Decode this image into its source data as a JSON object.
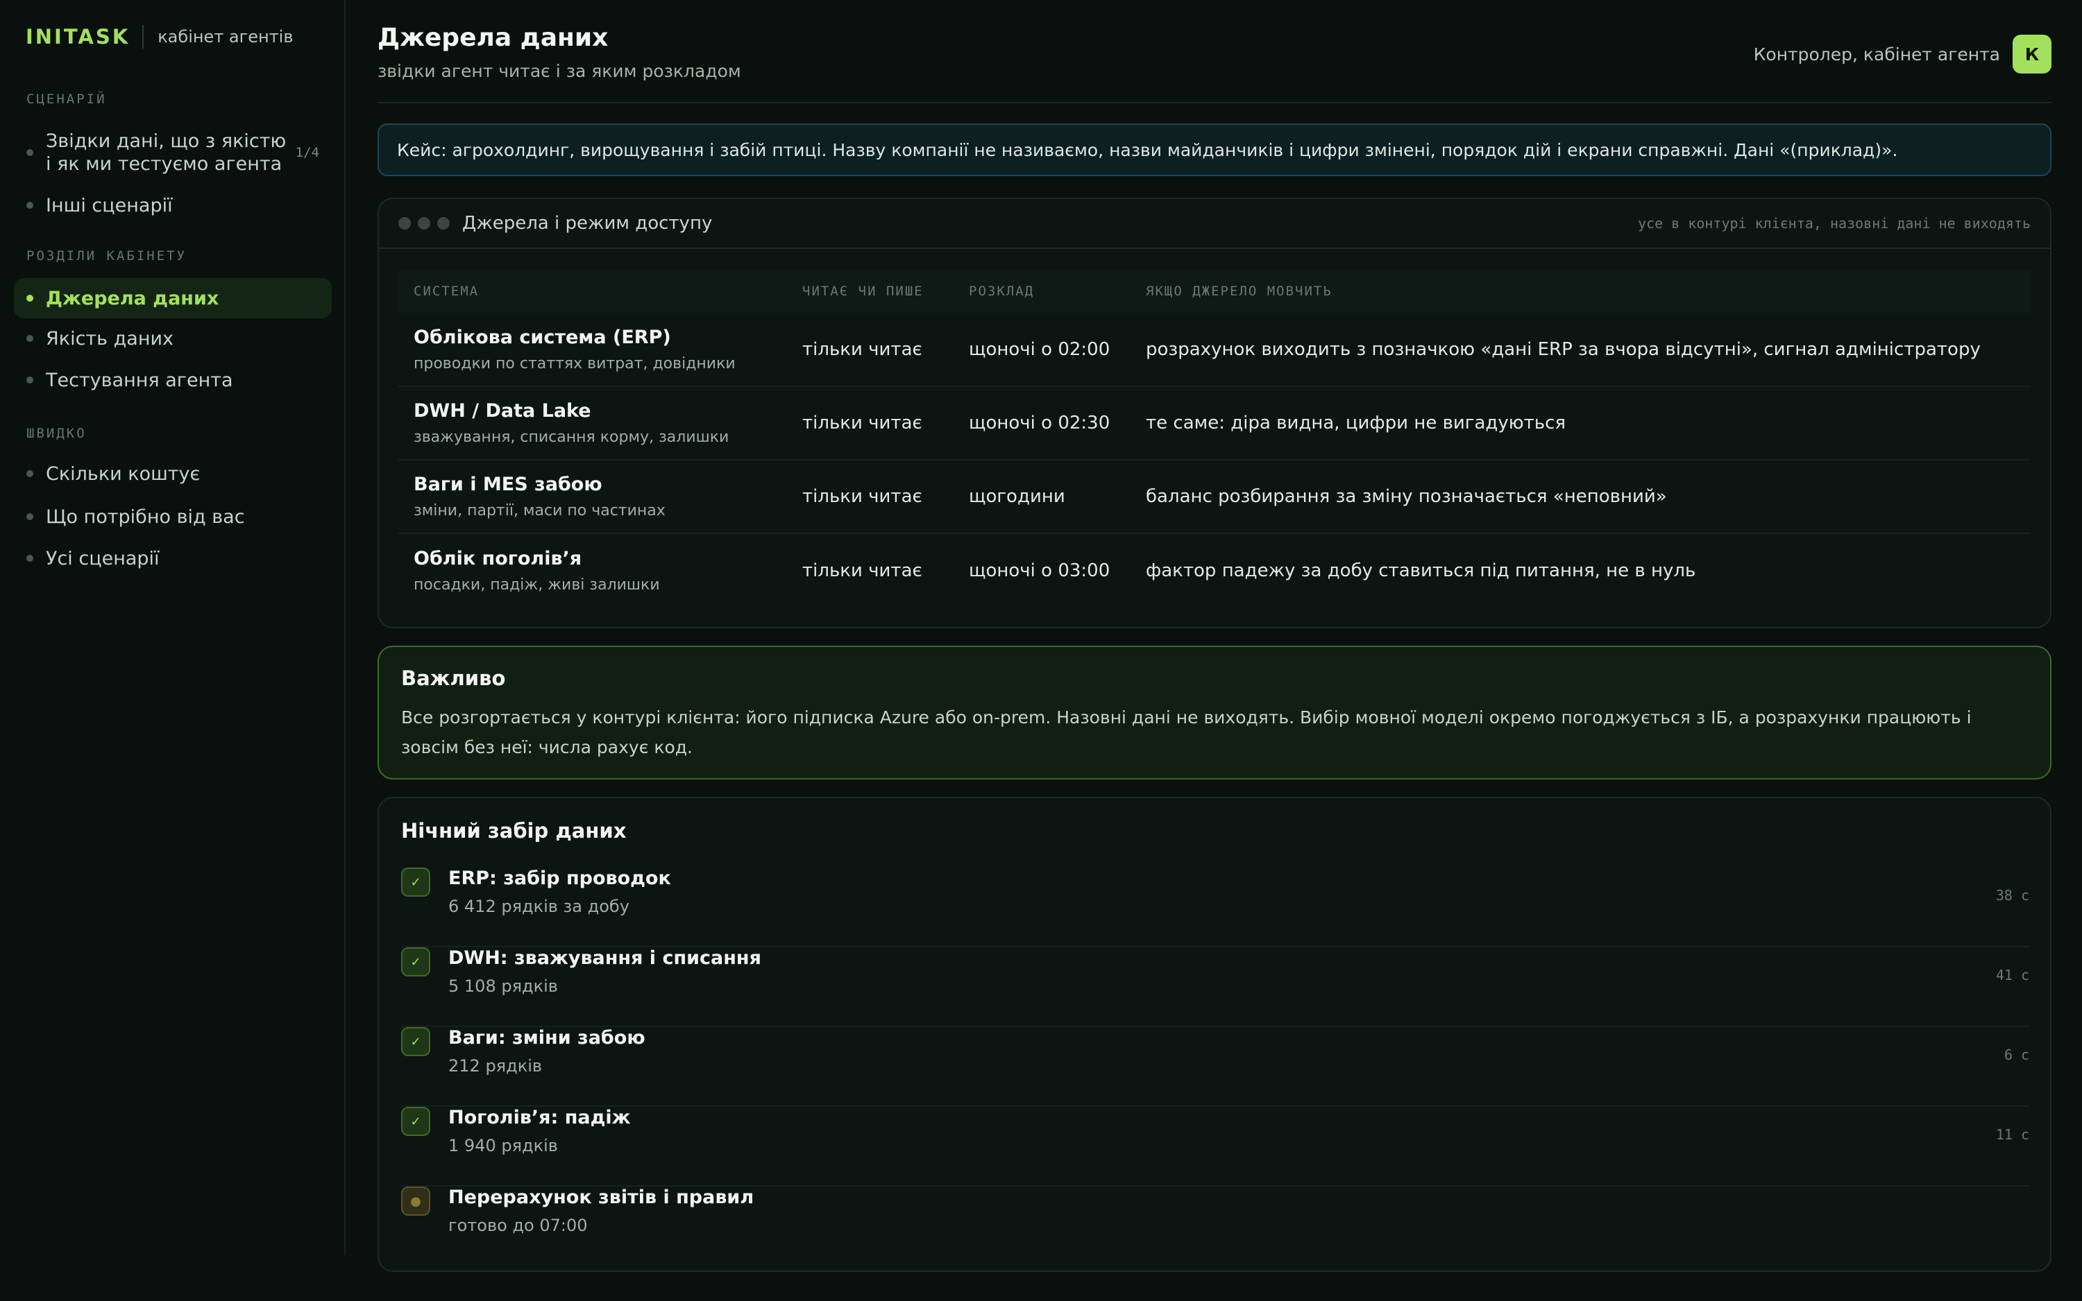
{
  "brand": {
    "logo": "INITASK",
    "subtitle": "кабінет агентів"
  },
  "sidebar": {
    "sections": [
      {
        "title": "СЦЕНАРІЙ",
        "items": [
          {
            "label_line1": "Звідки дані, що з якістю",
            "label_line2": "і як ми тестуємо агента",
            "badge": "1/4"
          },
          {
            "label": "Інші сценарії"
          }
        ]
      },
      {
        "title": "РОЗДІЛИ КАБІНЕТУ",
        "items": [
          {
            "label": "Джерела даних",
            "active": true
          },
          {
            "label": "Якість даних"
          },
          {
            "label": "Тестування агента"
          }
        ]
      },
      {
        "title": "ШВИДКО",
        "items": [
          {
            "label": "Скільки коштує"
          },
          {
            "label": "Що потрібно від вас"
          },
          {
            "label": "Усі сценарії"
          }
        ]
      }
    ]
  },
  "header": {
    "title": "Джерела даних",
    "subtitle": "звідки агент читає і за яким розкладом",
    "user_label": "Контролер, кабінет агента",
    "avatar_letter": "К"
  },
  "case_banner": "Кейс: агрохолдинг, вирощування і забій птиці. Назву компанії не називаємо, назви майданчиків і цифри змінені, порядок дій і екрани справжні. Дані «(приклад)».",
  "sources_card": {
    "title": "Джерела і режим доступу",
    "note": "усе в контурі клієнта, назовні дані не виходять",
    "columns": [
      "СИСТЕМА",
      "ЧИТАЄ ЧИ ПИШЕ",
      "РОЗКЛАД",
      "ЯКЩО ДЖЕРЕЛО МОВЧИТЬ"
    ],
    "rows": [
      {
        "system": "Облікова система (ERP)",
        "desc": "проводки по статтях витрат, довідники",
        "mode": "тільки читає",
        "schedule": "щоночі о 02:00",
        "fallback": "розрахунок виходить з позначкою «дані ERP за вчора відсутні», сигнал адміністратору"
      },
      {
        "system": "DWH / Data Lake",
        "desc": "зважування, списання корму, залишки",
        "mode": "тільки читає",
        "schedule": "щоночі о 02:30",
        "fallback": "те саме: діра видна, цифри не вигадуються"
      },
      {
        "system": "Ваги і MES забою",
        "desc": "зміни, партії, маси по частинах",
        "mode": "тільки читає",
        "schedule": "щогодини",
        "fallback": "баланс розбирання за зміну позначається «неповний»"
      },
      {
        "system": "Облік поголів’я",
        "desc": "посадки, падіж, живі залишки",
        "mode": "тільки читає",
        "schedule": "щоночі о 03:00",
        "fallback": "фактор падежу за добу ставиться під питання, не в нуль"
      }
    ]
  },
  "important": {
    "title": "Важливо",
    "text": "Все розгортається у контурі клієнта: його підписка Azure або on-prem. Назовні дані не виходять. Вибір мовної моделі окремо погоджується з ІБ, а розрахунки працюють і зовсім без неї: числа рахує код."
  },
  "night_jobs": {
    "title": "Нічний забір даних",
    "jobs": [
      {
        "title": "ERP: забір проводок",
        "desc": "6 412 рядків за добу",
        "time": "38 с",
        "status": "done",
        "icon": "check-icon"
      },
      {
        "title": "DWH: зважування і списання",
        "desc": "5 108 рядків",
        "time": "41 с",
        "status": "done",
        "icon": "check-icon"
      },
      {
        "title": "Ваги: зміни забою",
        "desc": "212 рядків",
        "time": "6 с",
        "status": "done",
        "icon": "check-icon"
      },
      {
        "title": "Поголів’я: падіж",
        "desc": "1 940 рядків",
        "time": "11 с",
        "status": "done",
        "icon": "check-icon"
      },
      {
        "title": "Перерахунок звітів і правил",
        "desc": "готово до 07:00",
        "time": "",
        "status": "pending",
        "icon": "pending-icon"
      }
    ],
    "check_glyph": "✓",
    "pending_glyph": "●"
  },
  "colors": {
    "accent": "#a3e05e",
    "background": "#0a100d",
    "banner_border": "#1f4656",
    "important_border": "#3f6a28"
  }
}
